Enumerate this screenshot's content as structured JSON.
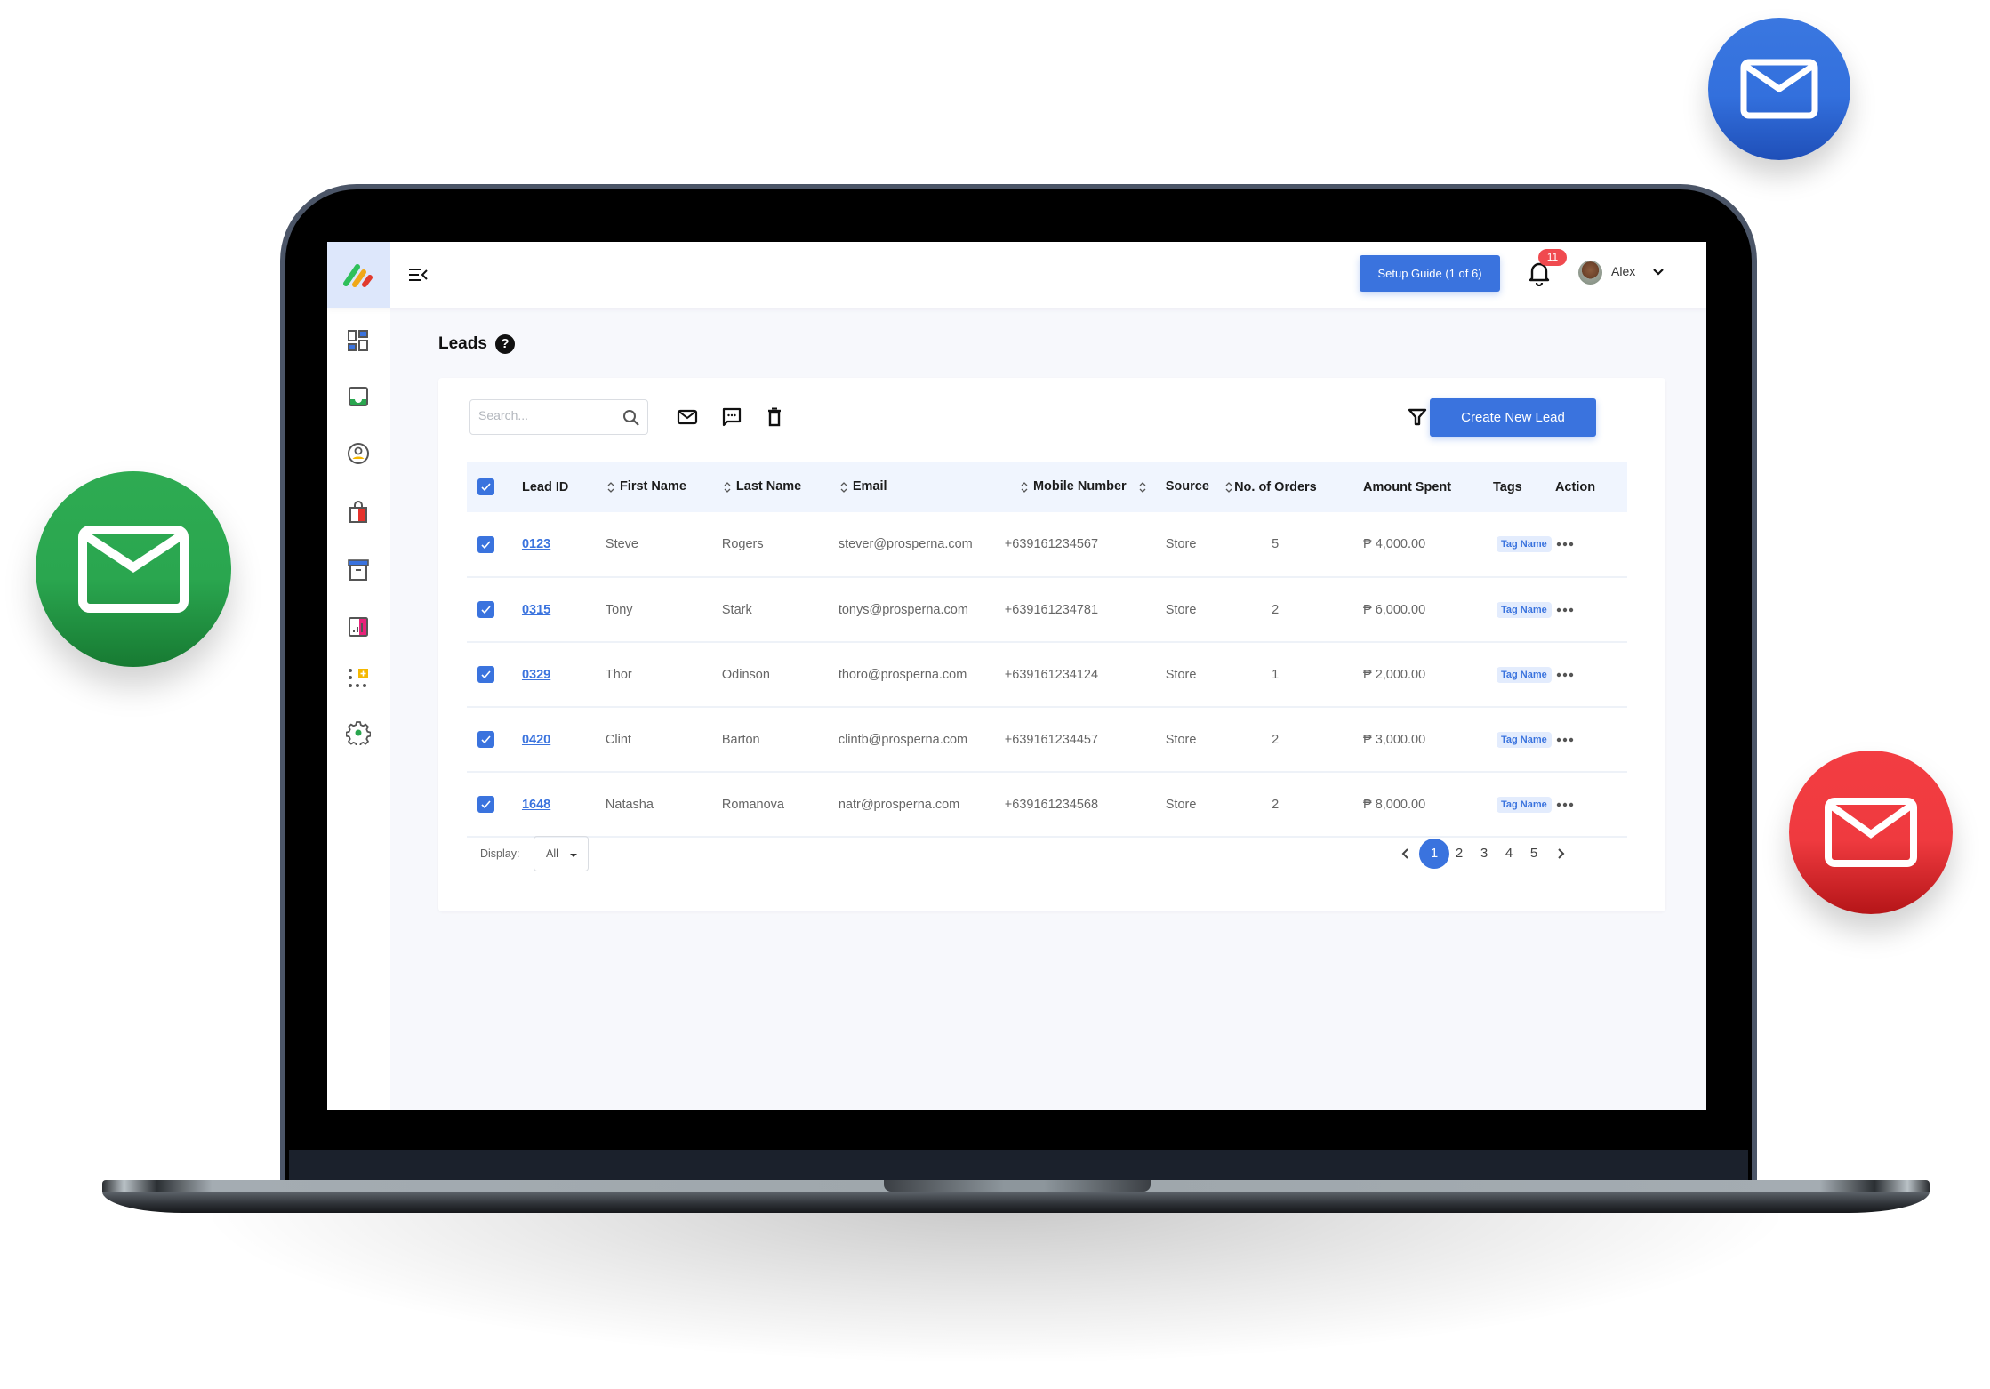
{
  "decor": {
    "bubbles": [
      {
        "name": "mail-bubble-blue",
        "color": "#3370dd"
      },
      {
        "name": "mail-bubble-green",
        "color": "#2aa64f"
      },
      {
        "name": "mail-bubble-red",
        "color": "#ef3a3f"
      }
    ]
  },
  "colors": {
    "accent": "#3a73de",
    "badge": "#f04a4f",
    "tag_bg": "#e3ecfd"
  },
  "header": {
    "setup_guide_label": "Setup Guide (1 of 6)",
    "notification_count": "11",
    "user_name": "Alex"
  },
  "sidebar": {
    "items": [
      {
        "name": "dashboard-icon",
        "label": "Dashboard"
      },
      {
        "name": "inbox-icon",
        "label": "Inbox"
      },
      {
        "name": "contacts-icon",
        "label": "Contacts"
      },
      {
        "name": "shopping-bag-icon",
        "label": "Orders"
      },
      {
        "name": "archive-icon",
        "label": "Products"
      },
      {
        "name": "reports-icon",
        "label": "Reports"
      },
      {
        "name": "add-apps-icon",
        "label": "Apps"
      },
      {
        "name": "settings-icon",
        "label": "Settings"
      }
    ]
  },
  "page": {
    "title": "Leads",
    "help_glyph": "?"
  },
  "toolbar": {
    "search_placeholder": "Search...",
    "create_label": "Create New Lead"
  },
  "table": {
    "columns": [
      "Lead ID",
      "First Name",
      "Last Name",
      "Email",
      "Mobile Number",
      "Source",
      "No. of Orders",
      "Amount Spent",
      "Tags",
      "Action"
    ],
    "rows": [
      {
        "id": "0123",
        "first": "Steve",
        "last": "Rogers",
        "email": "stever@prosperna.com",
        "mobile": "+639161234567",
        "source": "Store",
        "orders": "5",
        "amount": "₱ 4,000.00",
        "tag": "Tag Name",
        "checked": true
      },
      {
        "id": "0315",
        "first": "Tony",
        "last": "Stark",
        "email": "tonys@prosperna.com",
        "mobile": "+639161234781",
        "source": "Store",
        "orders": "2",
        "amount": "₱ 6,000.00",
        "tag": "Tag Name",
        "checked": true
      },
      {
        "id": "0329",
        "first": "Thor",
        "last": "Odinson",
        "email": "thoro@prosperna.com",
        "mobile": "+639161234124",
        "source": "Store",
        "orders": "1",
        "amount": "₱ 2,000.00",
        "tag": "Tag Name",
        "checked": true
      },
      {
        "id": "0420",
        "first": "Clint",
        "last": "Barton",
        "email": "clintb@prosperna.com",
        "mobile": "+639161234457",
        "source": "Store",
        "orders": "2",
        "amount": "₱ 3,000.00",
        "tag": "Tag Name",
        "checked": true
      },
      {
        "id": "1648",
        "first": "Natasha",
        "last": "Romanova",
        "email": "natr@prosperna.com",
        "mobile": "+639161234568",
        "source": "Store",
        "orders": "2",
        "amount": "₱ 8,000.00",
        "tag": "Tag Name",
        "checked": true
      }
    ]
  },
  "footer": {
    "display_label": "Display:",
    "display_value": "All",
    "pages": [
      "1",
      "2",
      "3",
      "4",
      "5"
    ],
    "current_page": "1"
  }
}
